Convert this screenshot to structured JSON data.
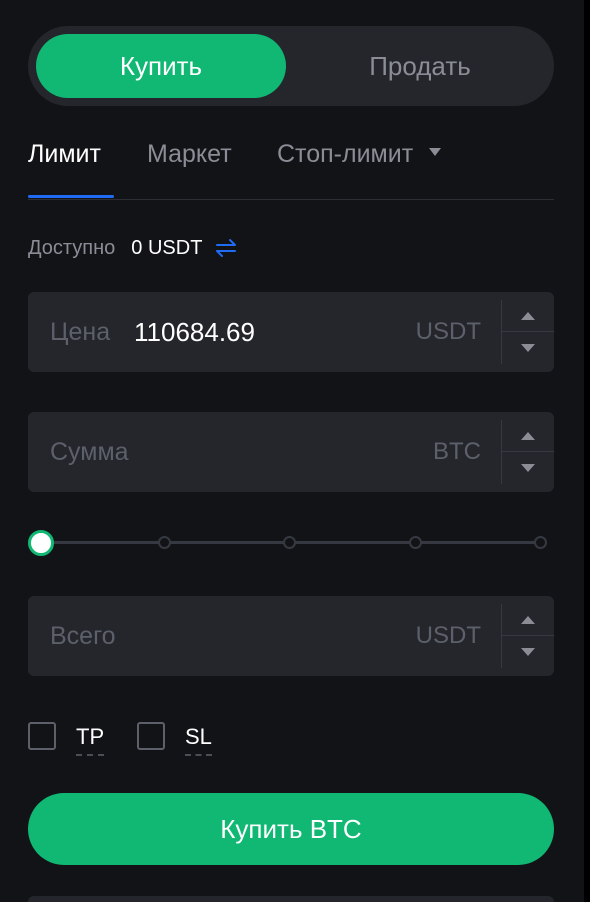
{
  "side_toggle": {
    "buy_label": "Купить",
    "sell_label": "Продать"
  },
  "order_tabs": [
    {
      "label": "Лимит",
      "active": true
    },
    {
      "label": "Маркет",
      "active": false
    },
    {
      "label": "Стоп-лимит",
      "active": false,
      "has_dropdown": true
    }
  ],
  "available": {
    "label": "Доступно",
    "value": "0 USDT",
    "icon": "swap-arrows-icon"
  },
  "price_field": {
    "label": "Цена",
    "value": "110684.69",
    "unit": "USDT"
  },
  "amount_field": {
    "placeholder": "Сумма",
    "value": "",
    "unit": "BTC"
  },
  "slider": {
    "value_percent": 0,
    "stops": [
      0,
      25,
      50,
      75,
      100
    ]
  },
  "total_field": {
    "placeholder": "Всего",
    "value": "",
    "unit": "USDT"
  },
  "tp_sl": {
    "tp_label": "TP",
    "sl_label": "SL",
    "tp_checked": false,
    "sl_checked": false
  },
  "submit_button": {
    "label": "Купить BTC"
  },
  "colors": {
    "accent_green": "#10b874",
    "tab_underline_blue": "#1f6bf3",
    "panel_bg": "#121317",
    "input_bg": "#24262c",
    "muted_text": "#8a8d96"
  }
}
